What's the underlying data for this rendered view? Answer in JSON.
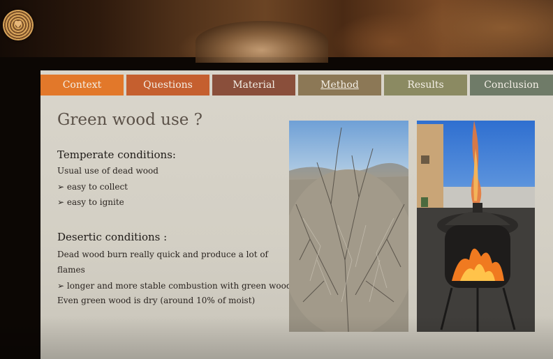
{
  "nav": {
    "tabs": [
      {
        "label": "Context",
        "color": "#e2782a",
        "active": false
      },
      {
        "label": "Questions",
        "color": "#c55f2f",
        "active": false
      },
      {
        "label": "Material",
        "color": "#8a4f3b",
        "active": false
      },
      {
        "label": "Method",
        "color": "#8c7856",
        "active": true
      },
      {
        "label": "Results",
        "color": "#8b8a62",
        "active": false
      },
      {
        "label": "Conclusion",
        "color": "#6f7b68",
        "active": false
      }
    ]
  },
  "slide": {
    "title": "Green wood use ?",
    "temperate": {
      "heading": "Temperate conditions:",
      "lines": [
        "Usual use of dead wood",
        "➢ easy to collect",
        "➢ easy to ignite"
      ]
    },
    "desertic": {
      "heading": "Desertic conditions :",
      "lines": [
        "Dead wood burn really quick and produce a lot of",
        "flames",
        "➢ longer and more stable combustion with green wood",
        "Even green wood is dry (around 10% of moist)"
      ]
    }
  },
  "colors": {
    "slide_background": "#d5d1c7",
    "title_text": "#5b5148"
  },
  "icons": {
    "logo": "tree-ring-heart-icon"
  }
}
